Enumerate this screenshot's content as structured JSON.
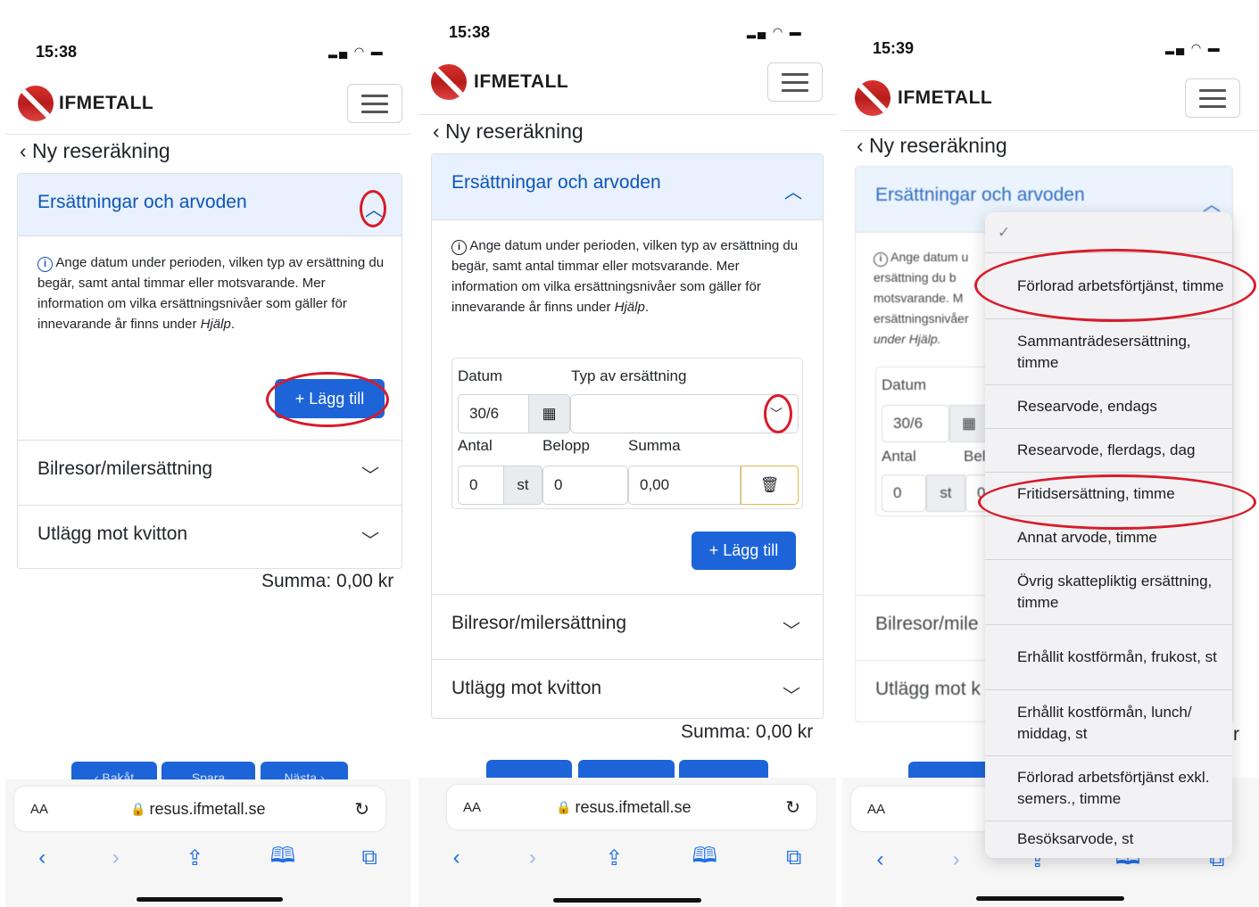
{
  "panels": [
    {
      "status_time": "15:38",
      "logo_text": "IFMETALL",
      "back_label": "‹ Ny reseräkning",
      "section_title": "Ersättningar och arvoden",
      "info_text_before": "Ange datum under perioden, vilken typ av ersättning du begär, samt antal timmar eller motsvarande. Mer information om vilka ersättningsnivåer som gäller för innevarande år finns under ",
      "info_link": "Hjälp",
      "info_text_after": ".",
      "add_button": "+ Lägg till",
      "section_2": "Bilresor/milersättning",
      "section_3": "Utlägg mot kvitton",
      "sum_label": "Summa: 0,00 kr",
      "bottom_buttons": [
        "‹ Bakåt",
        "Spara",
        "Nästa ›"
      ],
      "url_aa": "AA",
      "url_text": "resus.ifmetall.se"
    },
    {
      "status_time": "15:38",
      "logo_text": "IFMETALL",
      "back_label": "‹ Ny reseräkning",
      "section_title": "Ersättningar och arvoden",
      "info_text_before": "Ange datum under perioden, vilken typ av ersättning du begär, samt antal timmar eller motsvarande. Mer information om vilka ersättningsnivåer som gäller för innevarande år finns under ",
      "info_link": "Hjälp",
      "info_text_after": ".",
      "labels": {
        "datum": "Datum",
        "typ": "Typ av ersättning",
        "antal": "Antal",
        "belopp": "Belopp",
        "summa": "Summa"
      },
      "values": {
        "datum": "30/6",
        "typ": "",
        "antal": "0",
        "unit": "st",
        "belopp": "0",
        "summa": "0,00"
      },
      "add_button": "+ Lägg till",
      "section_2": "Bilresor/milersättning",
      "section_3": "Utlägg mot kvitton",
      "sum_label": "Summa: 0,00 kr",
      "url_aa": "AA",
      "url_text": "resus.ifmetall.se"
    },
    {
      "status_time": "15:39",
      "logo_text": "IFMETALL",
      "back_label": "‹ Ny reseräkning",
      "section_title": "Ersättningar och arvoden",
      "info_partial": [
        "Ange datum u",
        "ersättning du b",
        "motsvarande. M",
        "ersättningsnivåer",
        "under Hjälp."
      ],
      "labels": {
        "datum": "Datum",
        "antal": "Antal",
        "belopp": "Bel"
      },
      "values": {
        "datum": "30/6",
        "antal": "0",
        "unit": "st",
        "belopp": "0"
      },
      "section_2": "Bilresor/mile",
      "section_3": "Utlägg mot k",
      "sum_partial": "r",
      "url_aa": "AA",
      "dropdown_selected_mark": "✓",
      "dropdown_options": [
        "Förlorad arbetsförtjänst, timme",
        "Sammanträdesersättning, timme",
        "Researvode, endags",
        "Researvode, flerdags, dag",
        "Fritidsersättning, timme",
        "Annat arvode, timme",
        "Övrig skattepliktig ersättning, timme",
        "Erhållit kostförmån, frukost, st",
        "Erhållit kostförmån, lunch/ middag, st",
        "Förlorad arbetsförtjänst exkl. semers., timme",
        "Besöksarvode, st"
      ]
    }
  ],
  "colors": {
    "accent": "#1d64d8",
    "highlight_ring": "#d81b2a",
    "accordion_header_bg": "#e8f1fd",
    "accordion_header_text": "#0d55b8"
  }
}
